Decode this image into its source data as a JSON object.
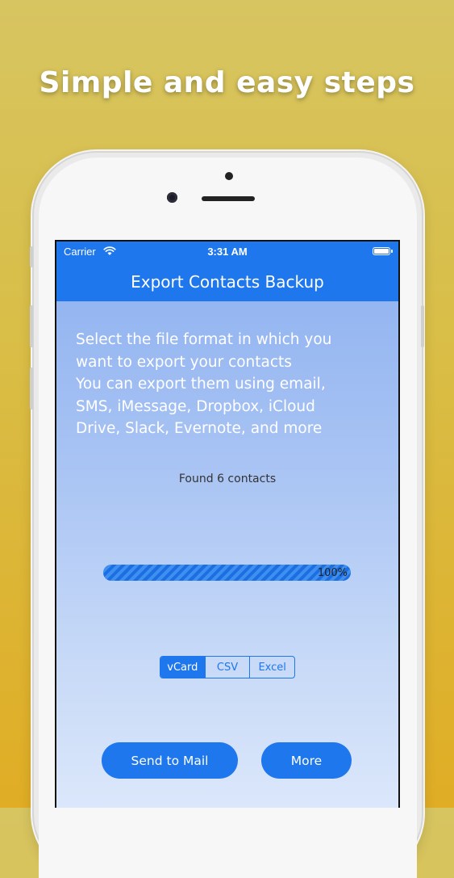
{
  "promo": {
    "title": "Simple and easy steps"
  },
  "status_bar": {
    "carrier": "Carrier",
    "time": "3:31 AM"
  },
  "nav": {
    "title": "Export Contacts Backup"
  },
  "description": "Select the file format in which you\nwant to export your contacts\nYou can export them using email,\nSMS, iMessage, Dropbox, iCloud\nDrive, Slack, Evernote, and more",
  "found": "Found 6 contacts",
  "progress": {
    "value": 1.0,
    "label": "100%"
  },
  "formats": {
    "options": [
      "vCard",
      "CSV",
      "Excel"
    ],
    "selected": "vCard"
  },
  "buttons": {
    "mail": "Send to Mail",
    "more": "More"
  },
  "colors": {
    "accent": "#1F77EE",
    "background": "#D9BD45"
  }
}
